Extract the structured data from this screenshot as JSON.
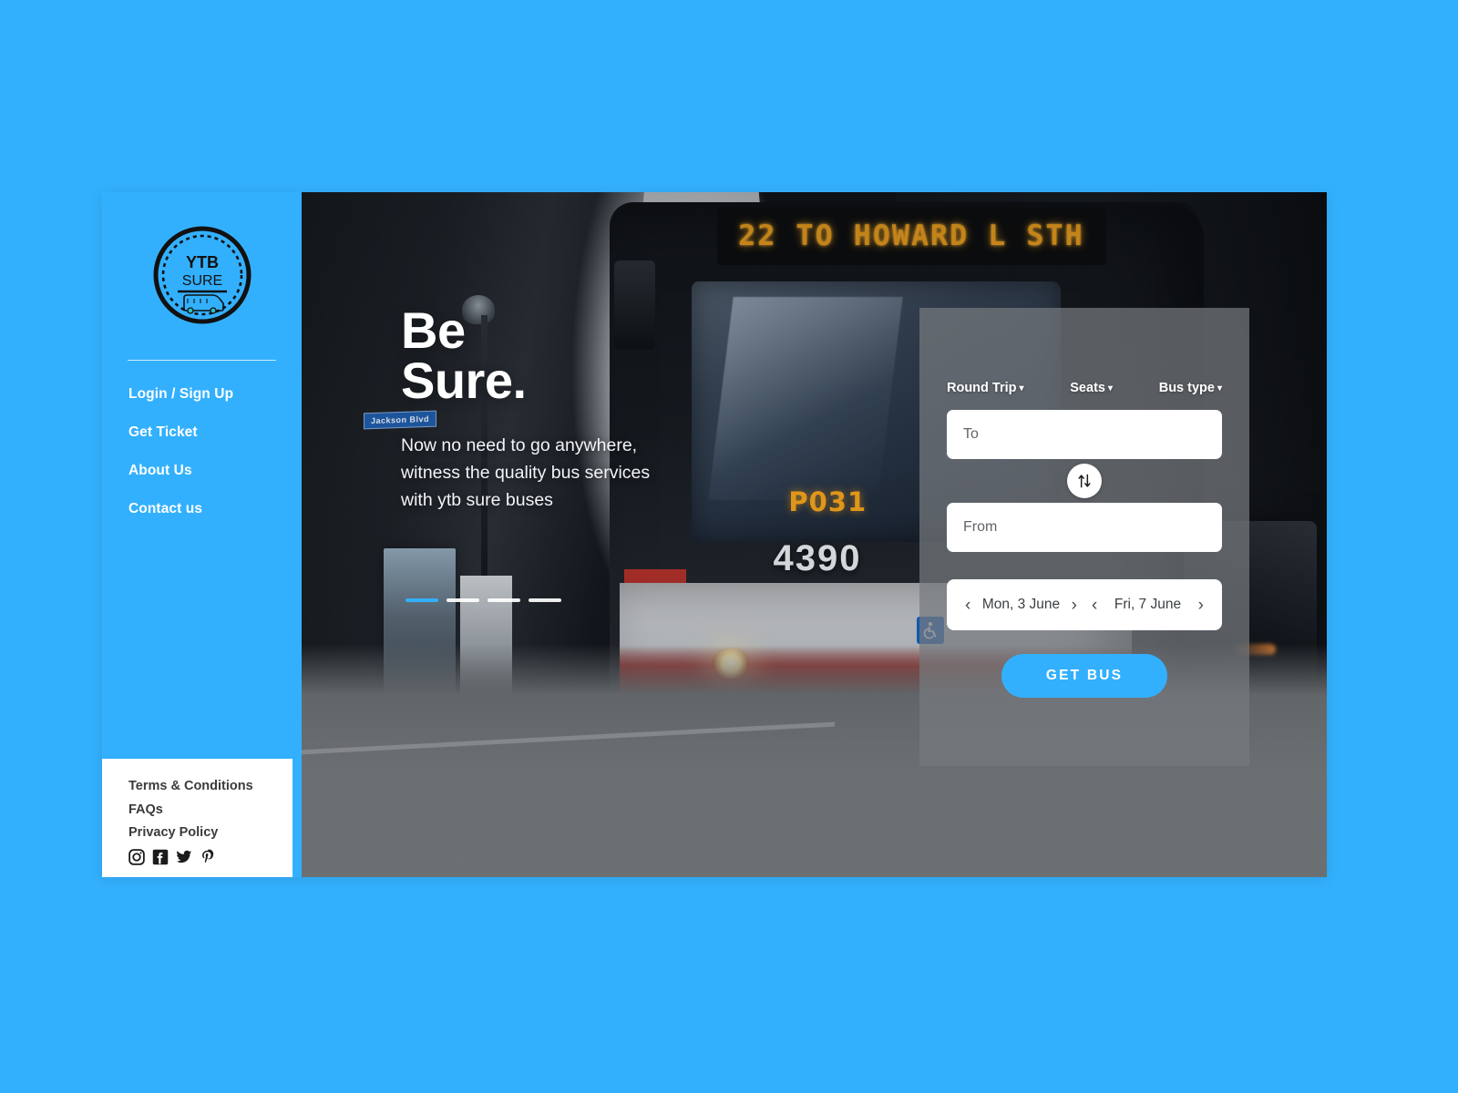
{
  "theme": {
    "brand_blue": "#33b0fd",
    "panel_overlay": "rgba(118,122,126,0.72)",
    "footer_bg": "#ffffff",
    "led_amber": "#f0a01a"
  },
  "sidebar": {
    "logo": {
      "line1": "YTB",
      "line2": "SURE",
      "icon": "bus-icon"
    },
    "nav_items": [
      {
        "label": "Login / Sign Up",
        "name": "login-signup"
      },
      {
        "label": "Get Ticket",
        "name": "get-ticket"
      },
      {
        "label": "About Us",
        "name": "about-us"
      },
      {
        "label": "Contact us",
        "name": "contact-us"
      }
    ],
    "footer_links": [
      {
        "label": "Terms & Conditions"
      },
      {
        "label": "FAQs"
      },
      {
        "label": "Privacy Policy"
      }
    ],
    "socials": [
      {
        "name": "instagram-icon"
      },
      {
        "name": "facebook-icon"
      },
      {
        "name": "twitter-icon"
      },
      {
        "name": "pinterest-icon"
      }
    ]
  },
  "hero": {
    "title": "Be\nSure.",
    "subtitle": "Now no need to go anywhere,\nwitness the quality bus services\nwith ytb sure buses",
    "carousel": {
      "slides": 4,
      "active_index": 0
    },
    "photo": {
      "led_destination": "22 TO HOWARD L STH",
      "route_code": "P031",
      "bus_number": "4390",
      "street_sign": "Jackson Blvd"
    }
  },
  "booking": {
    "options": [
      {
        "label": "Round Trip",
        "caret": "▾",
        "name": "trip-type-dropdown"
      },
      {
        "label": "Seats",
        "caret": "▾",
        "name": "seats-dropdown"
      },
      {
        "label": "Bus type",
        "caret": "▾",
        "name": "bus-type-dropdown"
      }
    ],
    "to_field": {
      "placeholder": "To",
      "value": ""
    },
    "from_field": {
      "placeholder": "From",
      "value": ""
    },
    "swap_icon": "swap-vertical-icon",
    "depart_date": "Mon, 3 June",
    "return_date": "Fri, 7 June",
    "prev_chevron": "‹",
    "next_chevron": "›",
    "submit_label": "GET BUS"
  }
}
